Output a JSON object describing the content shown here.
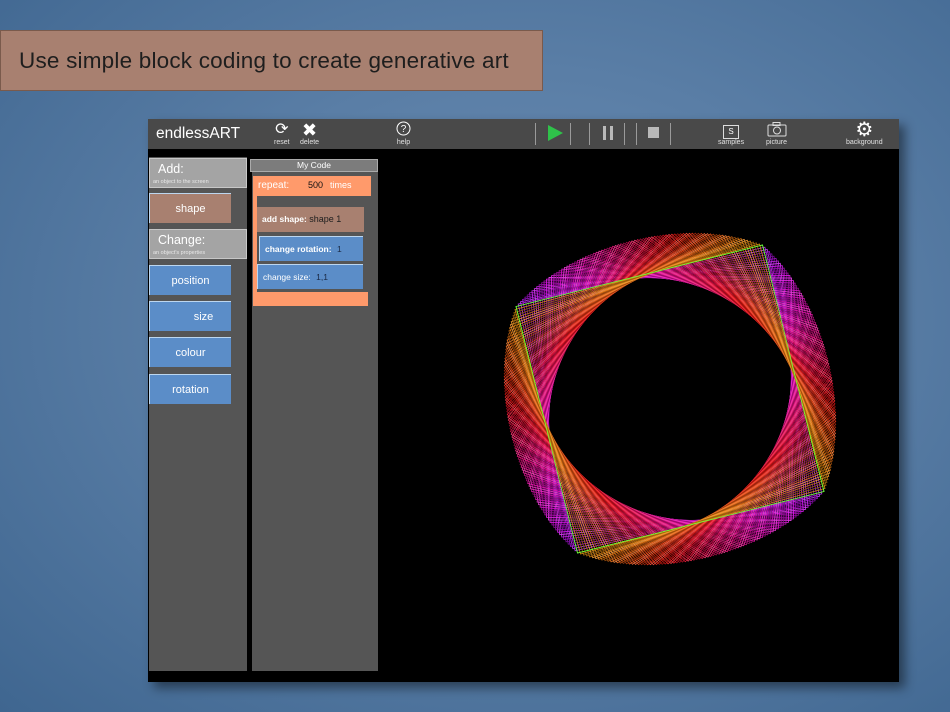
{
  "banner": {
    "text": "Use simple block coding to create generative art"
  },
  "app": {
    "title": "endlessART"
  },
  "toolbar": {
    "reset": "reset",
    "delete": "delete",
    "help": "help",
    "samples": "samples",
    "samples_glyph": "S",
    "picture": "picture",
    "background": "background",
    "play_color": "#2fc24a"
  },
  "palette": {
    "add_title": "Add:",
    "add_sub": "an object to the screen",
    "shape": "shape",
    "change_title": "Change:",
    "change_sub": "an object's properties",
    "blocks": [
      "position",
      "size",
      "colour",
      "rotation"
    ]
  },
  "code": {
    "tab": "My Code",
    "repeat_label": "repeat:",
    "repeat_value": "500",
    "repeat_unit": "times",
    "add_shape_label": "add shape:",
    "add_shape_value": "shape 1",
    "change_rotation_label": "change rotation:",
    "change_rotation_value": "1",
    "change_size_label": "change size:",
    "change_size_value": "1,1"
  },
  "colors": {
    "orange": "#ff9a6b",
    "brown": "#a88070",
    "blue": "#5b8dc8",
    "bar": "#494949"
  }
}
